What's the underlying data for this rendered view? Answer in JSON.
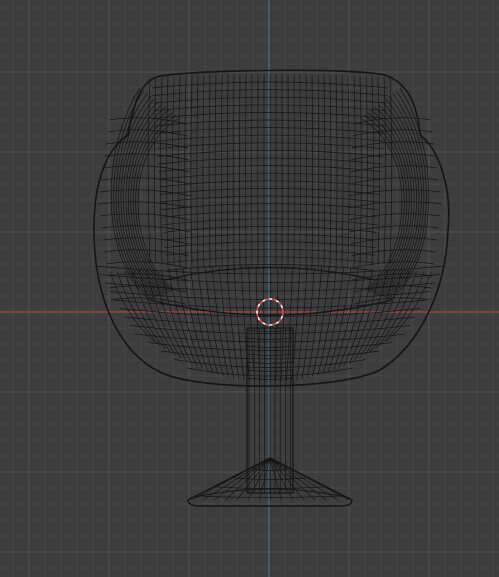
{
  "viewport": {
    "background_color": "#3d3d3d",
    "grid_minor_color": "#464646",
    "grid_major_color": "#525252",
    "x_axis_color": "#c04a52",
    "y_axis_color": "#4a78b8",
    "wire_color": "#141414",
    "origin_marker_color": "#ffffff",
    "origin_marker_accent": "#e05050"
  },
  "object": {
    "kind": "wireframe-mesh",
    "subject": "swivel-armchair",
    "parts": [
      "shell",
      "seat",
      "stem",
      "base"
    ]
  }
}
